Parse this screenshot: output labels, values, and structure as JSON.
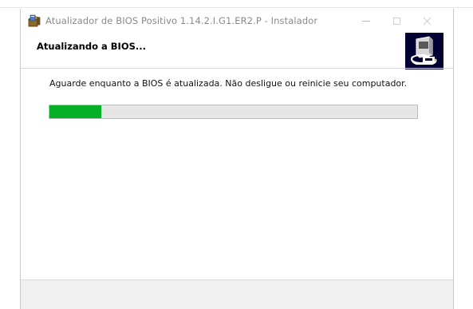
{
  "window": {
    "title": "Atualizador de BIOS Positivo 1.14.2.I.G1.ER2.P - Instalador",
    "icon": "installer-box-icon"
  },
  "header": {
    "title": "Atualizando a BIOS...",
    "logo_icon": "computer-disk-icon"
  },
  "body": {
    "message": "Aguarde enquanto a BIOS é atualizada. Não desligue ou reinicie seu computador."
  },
  "progress": {
    "fraction": 0.14,
    "fill_color": "#06b025"
  },
  "colors": {
    "logo_background": "#000033",
    "footer_background": "#f0f0f0"
  }
}
